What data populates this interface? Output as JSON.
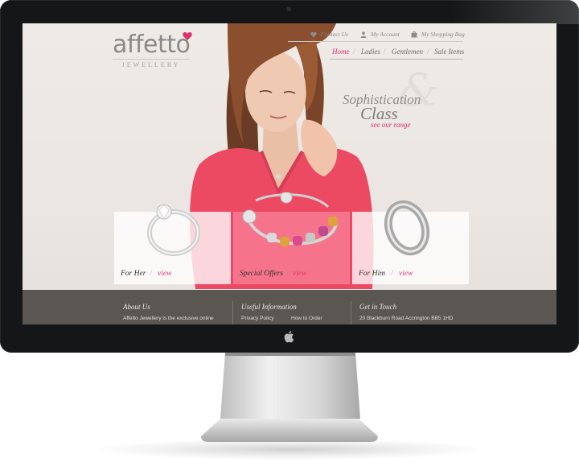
{
  "brand": {
    "logo_text": "affetto",
    "logo_sub": "JEWELLERY",
    "accent": "#e0316c"
  },
  "utility_nav": {
    "contact": "Contact Us",
    "account": "My Account",
    "bag": "My Shopping Bag"
  },
  "main_nav": {
    "items": [
      "Home",
      "Ladies",
      "Gentlemen",
      "Sale Items"
    ],
    "separator": "/"
  },
  "hero": {
    "line1": "Sophistication",
    "ampersand": "&",
    "line2": "Class",
    "link": "see our range"
  },
  "cards": [
    {
      "label": "For Her",
      "separator": "/",
      "link": "view"
    },
    {
      "label": "Special Offers",
      "separator": "/",
      "link": "view"
    },
    {
      "label": "For Him",
      "separator": "/",
      "link": "view"
    }
  ],
  "footer": {
    "about_title": "About Us",
    "about_text": "Affetto Jewellery is the exclusive online",
    "info_title": "Useful Information",
    "info_link1": "Privacy Policy",
    "info_link2": "How to Order",
    "touch_title": "Get in Touch",
    "touch_text": "20 Blackburn Road Accrington BB5 1HD"
  }
}
